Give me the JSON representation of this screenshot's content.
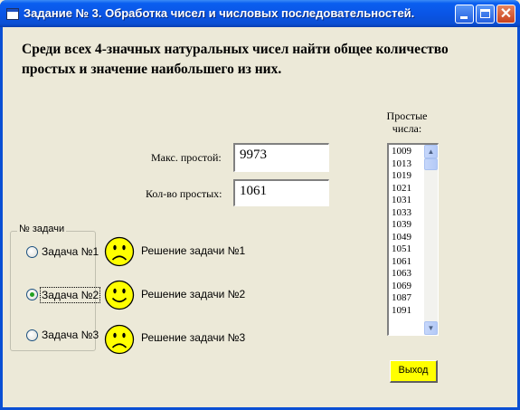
{
  "window": {
    "title": "Задание № 3.  Обработка чисел и числовых последовательностей."
  },
  "heading": {
    "line1": "Среди всех 4-значных натуральных чисел найти общее количество",
    "line2": "простых и значение наибольшего из них."
  },
  "max_prime": {
    "label": "Макс. простой:",
    "value": "9973"
  },
  "prime_count": {
    "label": "Кол-во простых:",
    "value": "1061"
  },
  "primes_list": {
    "label_line1": "Простые",
    "label_line2": "числа:",
    "items": [
      "1009",
      "1013",
      "1019",
      "1021",
      "1031",
      "1033",
      "1039",
      "1049",
      "1051",
      "1061",
      "1063",
      "1069",
      "1087",
      "1091"
    ]
  },
  "tasks": {
    "group_label": "№ задачи",
    "items": [
      {
        "label": "Задача №1",
        "solution": "Решение задачи №1",
        "selected": false,
        "mood": "sad"
      },
      {
        "label": "Задача №2",
        "solution": "Решение задачи №2",
        "selected": true,
        "mood": "happy"
      },
      {
        "label": "Задача №3",
        "solution": "Решение задачи №3",
        "selected": false,
        "mood": "sad"
      }
    ]
  },
  "exit_button": {
    "label": "Выход"
  },
  "colors": {
    "titlebar": "#0a55e6",
    "exit_button_bg": "#ffff00",
    "smiley_fill": "#ffff00",
    "radio_dot": "#21a121"
  }
}
